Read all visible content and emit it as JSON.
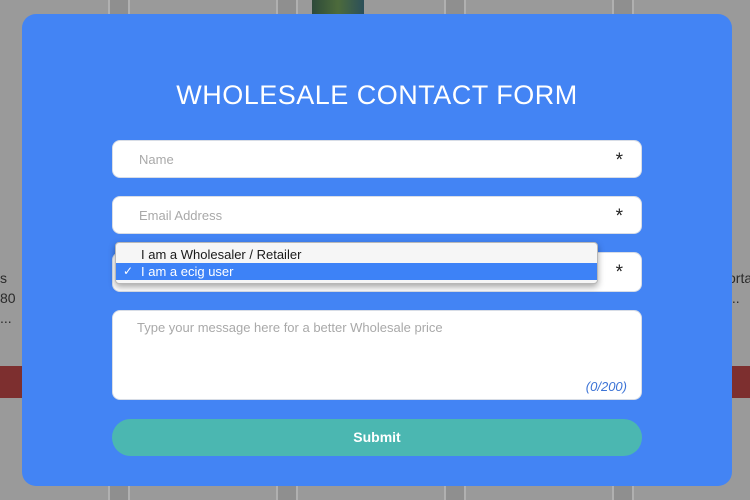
{
  "form": {
    "title": "WHOLESALE CONTACT FORM",
    "name_placeholder": "Name",
    "email_placeholder": "Email Address",
    "required_mark": "*",
    "message_placeholder": "Type your message here for a better Wholesale price",
    "message_counter": "(0/200)",
    "submit_label": "Submit",
    "colors": {
      "modal": "#4384f4",
      "submit": "#4bb7b1",
      "selected_option": "#3d82f7"
    }
  },
  "select": {
    "options": [
      {
        "label": "I am a Wholesaler / Retailer",
        "selected": false
      },
      {
        "label": "I am a ecig user",
        "selected": true
      }
    ],
    "selected_marker": "✓",
    "selected_marker_icon": "check-icon"
  },
  "background": {
    "left_text": "s 80 ...",
    "right_text": "orta ..."
  }
}
